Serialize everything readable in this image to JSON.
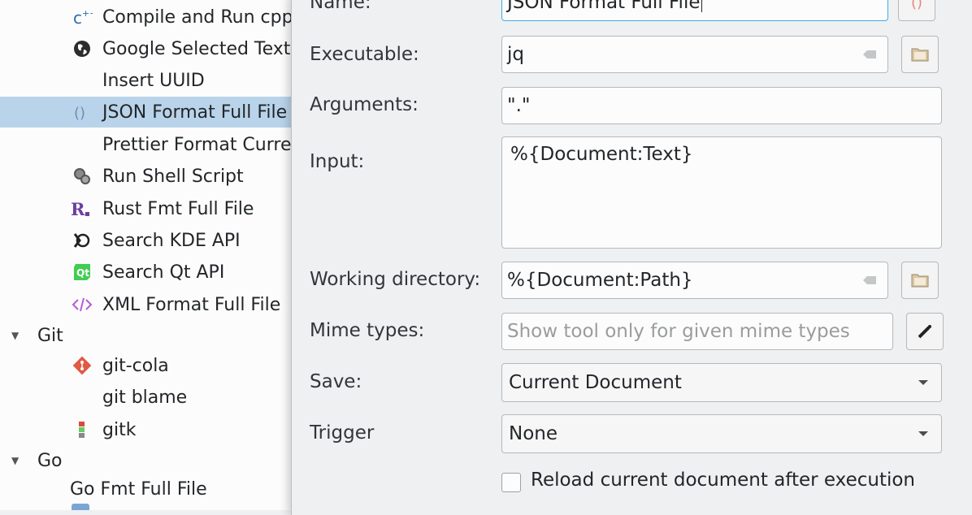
{
  "tree": {
    "items": [
      {
        "label": "Compile and Run cpp",
        "icon": "compile-icon"
      },
      {
        "label": "Google Selected Text",
        "icon": "globe-icon"
      },
      {
        "label": "Insert UUID",
        "icon": ""
      },
      {
        "label": "JSON Format Full File",
        "icon": "json-braces-icon",
        "selected": true
      },
      {
        "label": "Prettier Format Current",
        "icon": ""
      },
      {
        "label": "Run Shell Script",
        "icon": "shell-script-icon"
      },
      {
        "label": "Rust Fmt Full File",
        "icon": "rust-icon"
      },
      {
        "label": "Search KDE API",
        "icon": "kde-icon"
      },
      {
        "label": "Search Qt API",
        "icon": "qt-icon"
      },
      {
        "label": "XML Format Full File",
        "icon": "xml-icon"
      }
    ],
    "git_group": "Git",
    "git_items": [
      {
        "label": "git-cola",
        "icon": "git-cola-icon"
      },
      {
        "label": "git blame",
        "icon": ""
      },
      {
        "label": "gitk",
        "icon": "gitk-icon"
      }
    ],
    "go_group": "Go",
    "go_items": [
      {
        "label": "Go Fmt Full File",
        "icon": ""
      }
    ]
  },
  "form": {
    "name_label": "Name:",
    "name_value": "JSON Format Full File",
    "executable_label": "Executable:",
    "executable_value": "jq",
    "arguments_label": "Arguments:",
    "arguments_value": "\".\"",
    "input_label": "Input:",
    "input_value": "%{Document:Text}",
    "workdir_label": "Working directory:",
    "workdir_value": "%{Document:Path}",
    "mime_label": "Mime types:",
    "mime_placeholder": "Show tool only for given mime types",
    "save_label": "Save:",
    "save_value": "Current Document",
    "trigger_label": "Trigger",
    "trigger_value": "None",
    "reload_label": "Reload current document after execution",
    "reload_checked": false
  },
  "colors": {
    "selection": "#b9d4ea",
    "focus_border": "#3daee9"
  }
}
